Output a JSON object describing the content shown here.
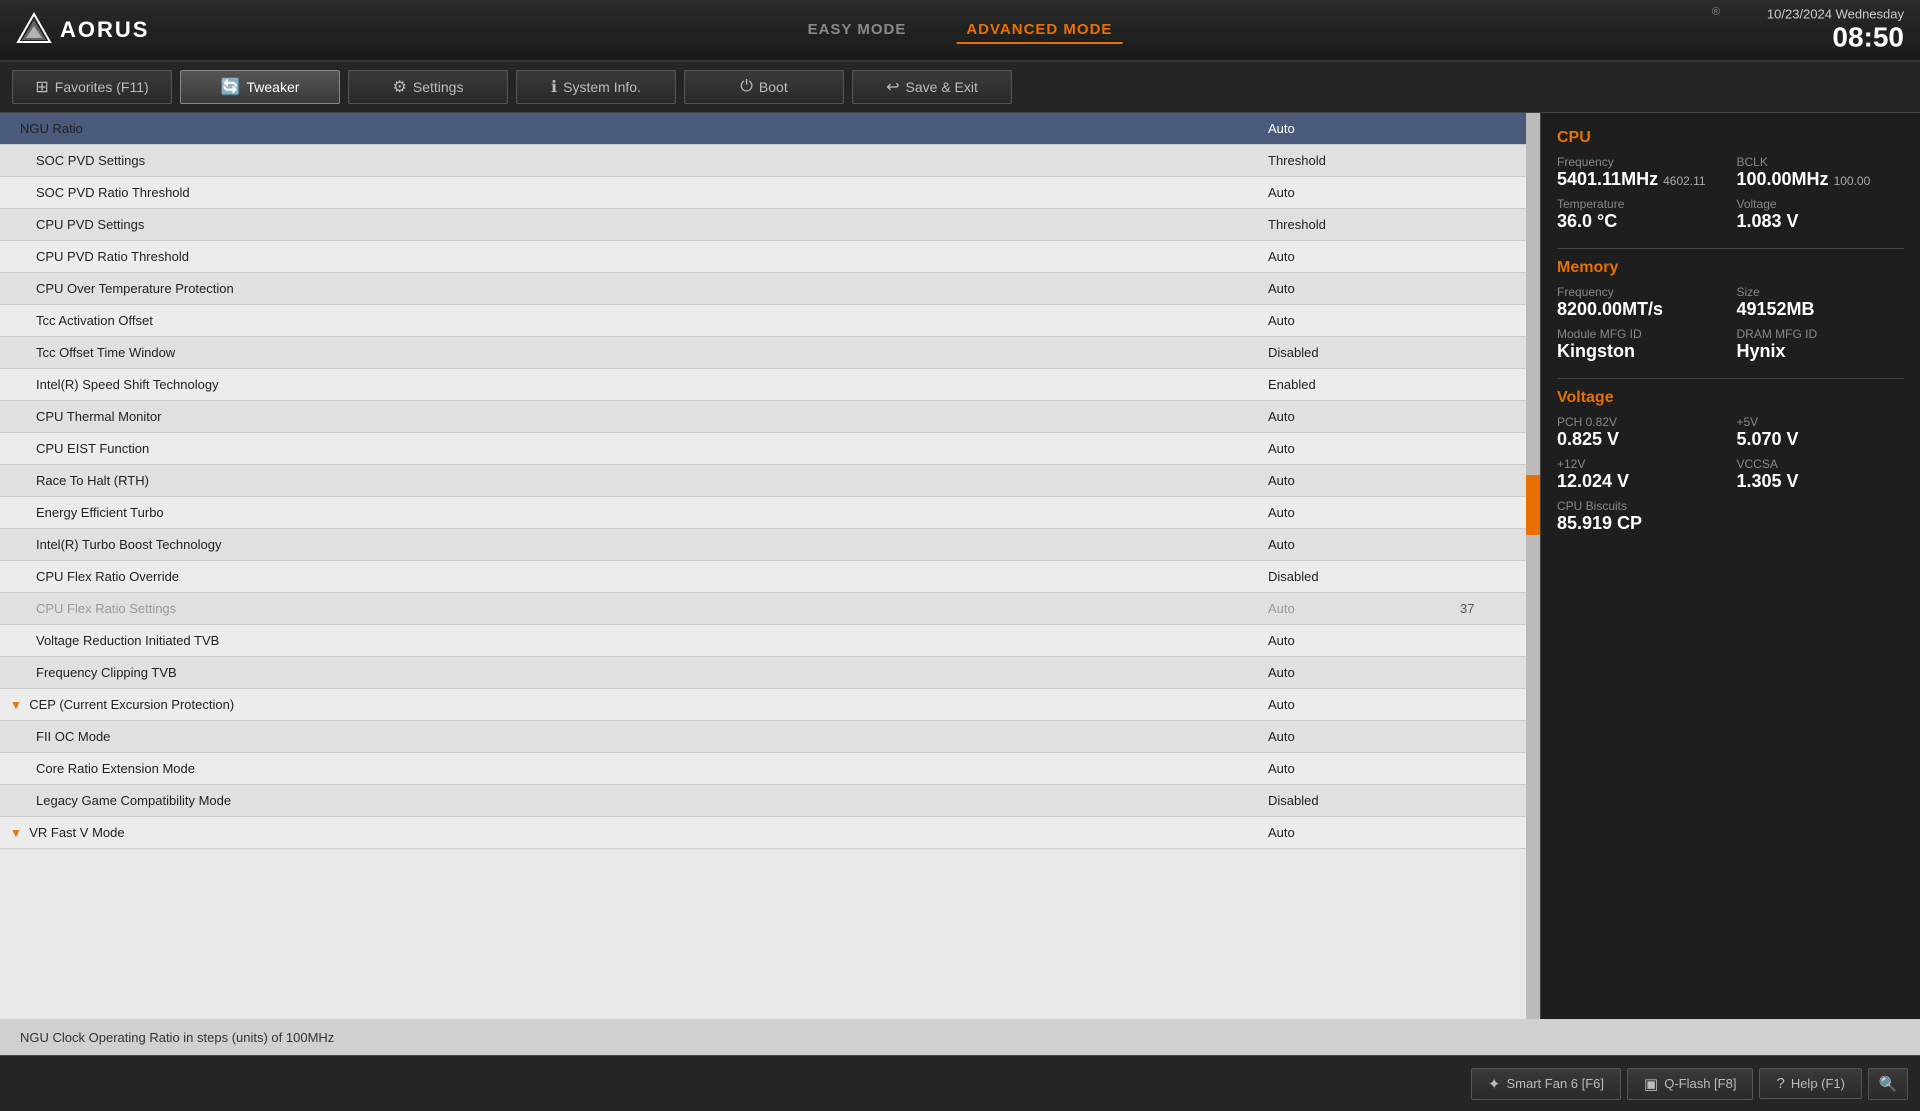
{
  "header": {
    "logo_text": "AORUS",
    "easy_mode_label": "EASY MODE",
    "advanced_mode_label": "ADVANCED MODE",
    "date": "10/23/2024 Wednesday",
    "time": "08:50"
  },
  "navbar": {
    "favorites_label": "Favorites (F11)",
    "tweaker_label": "Tweaker",
    "settings_label": "Settings",
    "sysinfo_label": "System Info.",
    "boot_label": "Boot",
    "save_exit_label": "Save & Exit"
  },
  "settings": {
    "rows": [
      {
        "name": "NGU Ratio",
        "value": "Auto",
        "extra": "",
        "highlight": true,
        "indented": false,
        "arrow": false,
        "disabled": false
      },
      {
        "name": "SOC PVD Settings",
        "value": "Threshold",
        "extra": "",
        "highlight": false,
        "indented": true,
        "arrow": false,
        "disabled": false
      },
      {
        "name": "SOC PVD Ratio Threshold",
        "value": "Auto",
        "extra": "",
        "highlight": false,
        "indented": true,
        "arrow": false,
        "disabled": false
      },
      {
        "name": "CPU PVD Settings",
        "value": "Threshold",
        "extra": "",
        "highlight": false,
        "indented": true,
        "arrow": false,
        "disabled": false
      },
      {
        "name": "CPU PVD Ratio Threshold",
        "value": "Auto",
        "extra": "",
        "highlight": false,
        "indented": true,
        "arrow": false,
        "disabled": false
      },
      {
        "name": "CPU Over Temperature Protection",
        "value": "Auto",
        "extra": "",
        "highlight": false,
        "indented": true,
        "arrow": false,
        "disabled": false
      },
      {
        "name": "Tcc Activation Offset",
        "value": "Auto",
        "extra": "",
        "highlight": false,
        "indented": true,
        "arrow": false,
        "disabled": false
      },
      {
        "name": "Tcc Offset Time Window",
        "value": "Disabled",
        "extra": "",
        "highlight": false,
        "indented": true,
        "arrow": false,
        "disabled": false
      },
      {
        "name": "Intel(R) Speed Shift Technology",
        "value": "Enabled",
        "extra": "",
        "highlight": false,
        "indented": true,
        "arrow": false,
        "disabled": false
      },
      {
        "name": "CPU Thermal Monitor",
        "value": "Auto",
        "extra": "",
        "highlight": false,
        "indented": true,
        "arrow": false,
        "disabled": false
      },
      {
        "name": "CPU EIST Function",
        "value": "Auto",
        "extra": "",
        "highlight": false,
        "indented": true,
        "arrow": false,
        "disabled": false
      },
      {
        "name": "Race To Halt (RTH)",
        "value": "Auto",
        "extra": "",
        "highlight": false,
        "indented": true,
        "arrow": false,
        "disabled": false
      },
      {
        "name": "Energy Efficient Turbo",
        "value": "Auto",
        "extra": "",
        "highlight": false,
        "indented": true,
        "arrow": false,
        "disabled": false
      },
      {
        "name": "Intel(R) Turbo Boost Technology",
        "value": "Auto",
        "extra": "",
        "highlight": false,
        "indented": true,
        "arrow": false,
        "disabled": false
      },
      {
        "name": "CPU Flex Ratio Override",
        "value": "Disabled",
        "extra": "",
        "highlight": false,
        "indented": true,
        "arrow": false,
        "disabled": false
      },
      {
        "name": "CPU Flex Ratio Settings",
        "value": "Auto",
        "extra": "37",
        "highlight": false,
        "indented": true,
        "arrow": false,
        "disabled": true
      },
      {
        "name": "Voltage Reduction Initiated TVB",
        "value": "Auto",
        "extra": "",
        "highlight": false,
        "indented": true,
        "arrow": false,
        "disabled": false
      },
      {
        "name": "Frequency Clipping TVB",
        "value": "Auto",
        "extra": "",
        "highlight": false,
        "indented": true,
        "arrow": false,
        "disabled": false
      },
      {
        "name": "CEP (Current Excursion Protection)",
        "value": "Auto",
        "extra": "",
        "highlight": false,
        "indented": true,
        "arrow": true,
        "disabled": false
      },
      {
        "name": "FII OC Mode",
        "value": "Auto",
        "extra": "",
        "highlight": false,
        "indented": true,
        "arrow": false,
        "disabled": false
      },
      {
        "name": "Core Ratio Extension Mode",
        "value": "Auto",
        "extra": "",
        "highlight": false,
        "indented": true,
        "arrow": false,
        "disabled": false
      },
      {
        "name": "Legacy Game Compatibility Mode",
        "value": "Disabled",
        "extra": "",
        "highlight": false,
        "indented": true,
        "arrow": false,
        "disabled": false
      },
      {
        "name": "VR Fast V Mode",
        "value": "Auto",
        "extra": "",
        "highlight": false,
        "indented": true,
        "arrow": true,
        "disabled": false
      }
    ]
  },
  "info_panel": {
    "cpu_title": "CPU",
    "cpu_frequency_label": "Frequency",
    "cpu_frequency_value": "5401.11MHz",
    "cpu_frequency_small": "4602.11",
    "bclk_label": "BCLK",
    "bclk_value": "100.00MHz",
    "bclk_small": "100.00",
    "temperature_label": "Temperature",
    "temperature_value": "36.0 °C",
    "voltage_label": "Voltage",
    "voltage_value": "1.083 V",
    "memory_title": "Memory",
    "mem_frequency_label": "Frequency",
    "mem_frequency_value": "8200.00MT/s",
    "mem_size_label": "Size",
    "mem_size_value": "49152MB",
    "module_mfg_label": "Module MFG ID",
    "module_mfg_value": "Kingston",
    "dram_mfg_label": "DRAM MFG ID",
    "dram_mfg_value": "Hynix",
    "voltage_section_title": "Voltage",
    "pch_label": "PCH 0.82V",
    "pch_value": "0.825 V",
    "plus5v_label": "+5V",
    "plus5v_value": "5.070 V",
    "plus12v_label": "+12V",
    "plus12v_value": "12.024 V",
    "vccsa_label": "VCCSA",
    "vccsa_value": "1.305 V",
    "cpu_biscuits_label": "CPU Biscuits",
    "cpu_biscuits_value": "85.919 CP"
  },
  "description": "NGU Clock Operating Ratio in steps (units) of 100MHz",
  "footer": {
    "smart_fan_label": "Smart Fan 6 [F6]",
    "qflash_label": "Q-Flash [F8]",
    "help_label": "Help (F1)"
  }
}
